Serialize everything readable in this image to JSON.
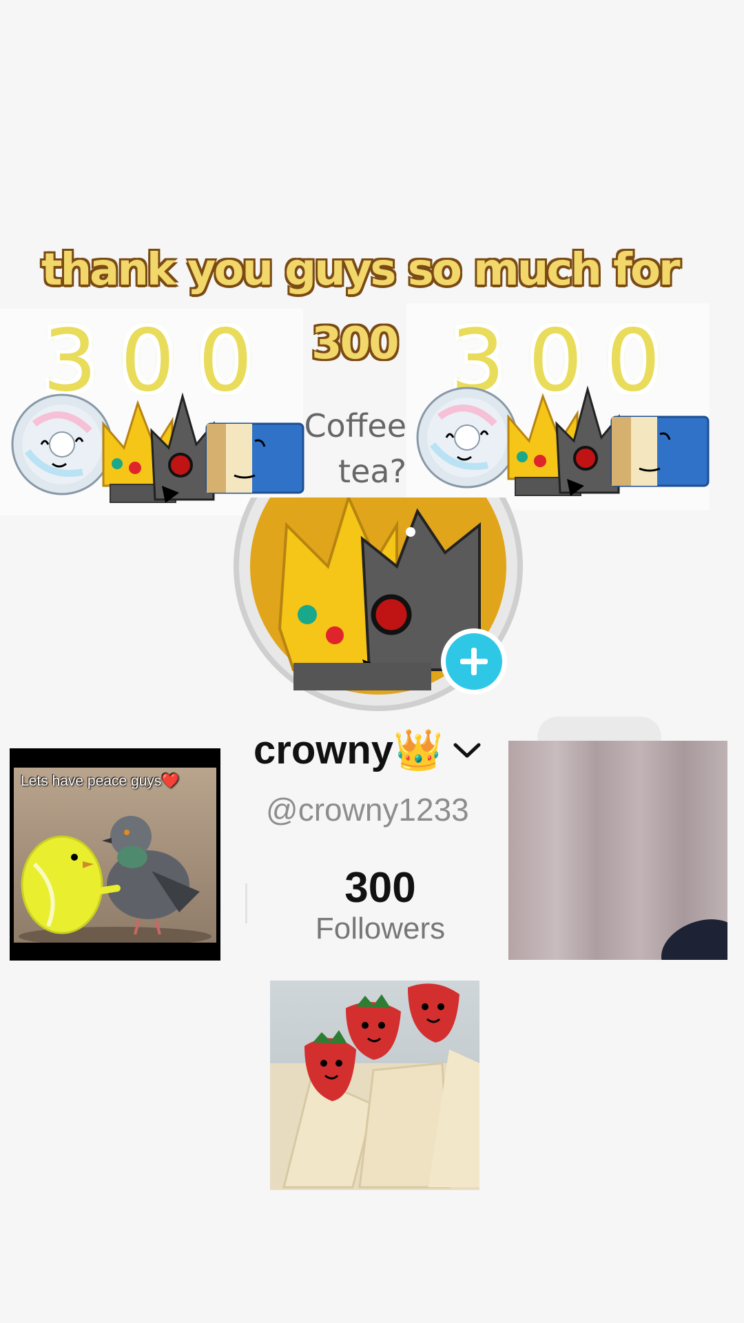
{
  "overlay": {
    "headline": "thank you guys so much for",
    "milestone_small": "300",
    "milestone_big_left": "300",
    "milestone_big_right": "300"
  },
  "background_profile": {
    "bio_line1": "Coffee",
    "bio_line2": "tea?",
    "display_name": "crowny👑",
    "handle": "@crowny1233",
    "followers_count": "300",
    "followers_label": "Followers"
  },
  "meme_left": {
    "caption": "Lets have peace guys❤️"
  },
  "colors": {
    "headline_fill": "#f2d76a",
    "headline_outline": "#7a4a14",
    "add_button": "#2ec8e6",
    "avatar_bg": "#e0a51b"
  },
  "icons": [
    "disc-icon",
    "crown-icon",
    "robot-crown-icon",
    "dollar-bill-icon",
    "plus-icon",
    "chevron-down-icon"
  ]
}
